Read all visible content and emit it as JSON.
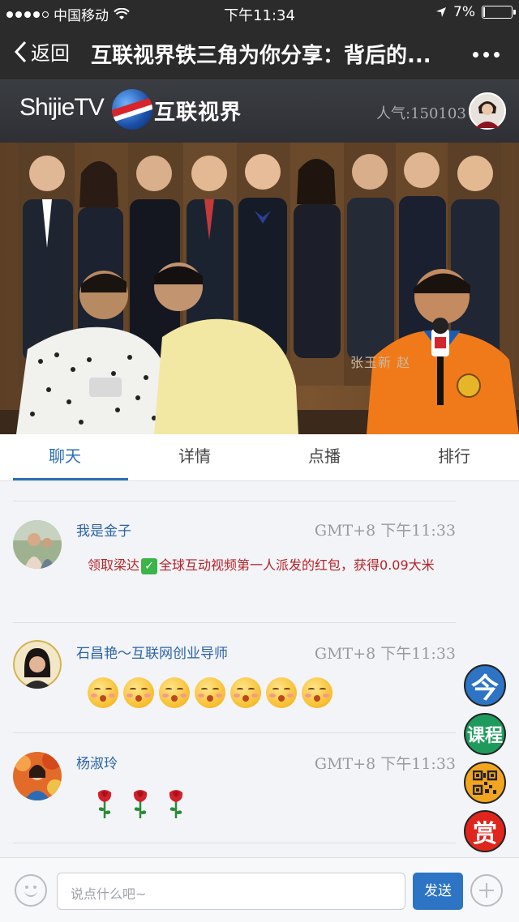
{
  "status_bar": {
    "carrier": "中国移动",
    "time": "下午11:34",
    "battery_text": "7%",
    "battery_level": 0.07
  },
  "nav": {
    "back_label": "返回",
    "title": "互联视界铁三角为你分享：背后的..."
  },
  "channel": {
    "logo_text": "ShijieTV",
    "logo_cn": "互联视界",
    "popularity": "人气:150103"
  },
  "video": {
    "caption": "张玉新   赵"
  },
  "tabs": [
    {
      "label": "聊天",
      "active": true
    },
    {
      "label": "详情",
      "active": false
    },
    {
      "label": "点播",
      "active": false
    },
    {
      "label": "排行",
      "active": false
    }
  ],
  "messages": [
    {
      "name": "我是金子",
      "time": "GMT+8 下午11:33",
      "text_before": "领取梁达",
      "text_after": "全球互动视频第一人派发的红包，获得0.09大米"
    },
    {
      "name": "石昌艳～互联网创业导师",
      "time": "GMT+8 下午11:33",
      "emoji_count": 7,
      "emoji_icon": "kissing-face-icon"
    },
    {
      "name": "杨淑玲",
      "time": "GMT+8 下午11:33",
      "rose_count": 3,
      "rose_icon": "rose-icon"
    }
  ],
  "floating": {
    "btn1": "今",
    "btn2": "课程",
    "btn4": "赏"
  },
  "input": {
    "placeholder": "说点什么吧~",
    "send_label": "发送"
  },
  "colors": {
    "accent": "#2d6fb4",
    "message_red": "#b4242a",
    "fab_blue": "#2d74c4",
    "fab_green": "#1e9b5c",
    "fab_orange": "#f2a51e",
    "fab_red": "#e0251d"
  }
}
